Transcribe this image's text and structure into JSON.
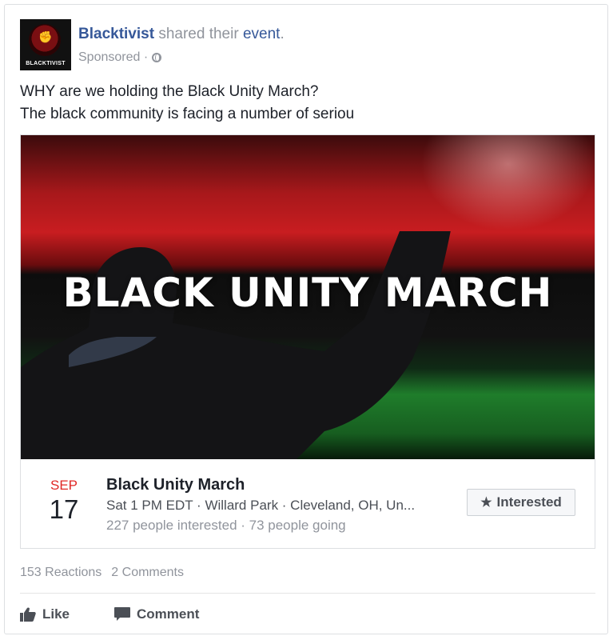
{
  "post": {
    "page_name": "Blacktivist",
    "action_text": " shared their ",
    "event_link": "event",
    "period": ".",
    "sponsored": "Sponsored ·",
    "text_line1": "WHY are we holding the Black Unity March?",
    "text_line2": "The black community is facing a number of seriou",
    "avatar_label": "BLACKTIVIST"
  },
  "event": {
    "banner_text": "BLACK UNITY MARCH",
    "month": "SEP",
    "day": "17",
    "title": "Black Unity March",
    "when_where": "Sat 1 PM EDT · Willard Park · Cleveland, OH, Un...",
    "stats": "227 people interested · 73 people going",
    "interested_label": "Interested"
  },
  "footer": {
    "reactions": "153 Reactions",
    "comments": "2 Comments",
    "like_label": "Like",
    "comment_label": "Comment"
  },
  "icons": {
    "globe": "globe-icon",
    "star": "star-icon",
    "like": "thumbs-up-icon",
    "comment": "speech-bubble-icon"
  },
  "colors": {
    "link": "#365899",
    "date_month": "#e02826",
    "secondary_text": "#90949c"
  }
}
